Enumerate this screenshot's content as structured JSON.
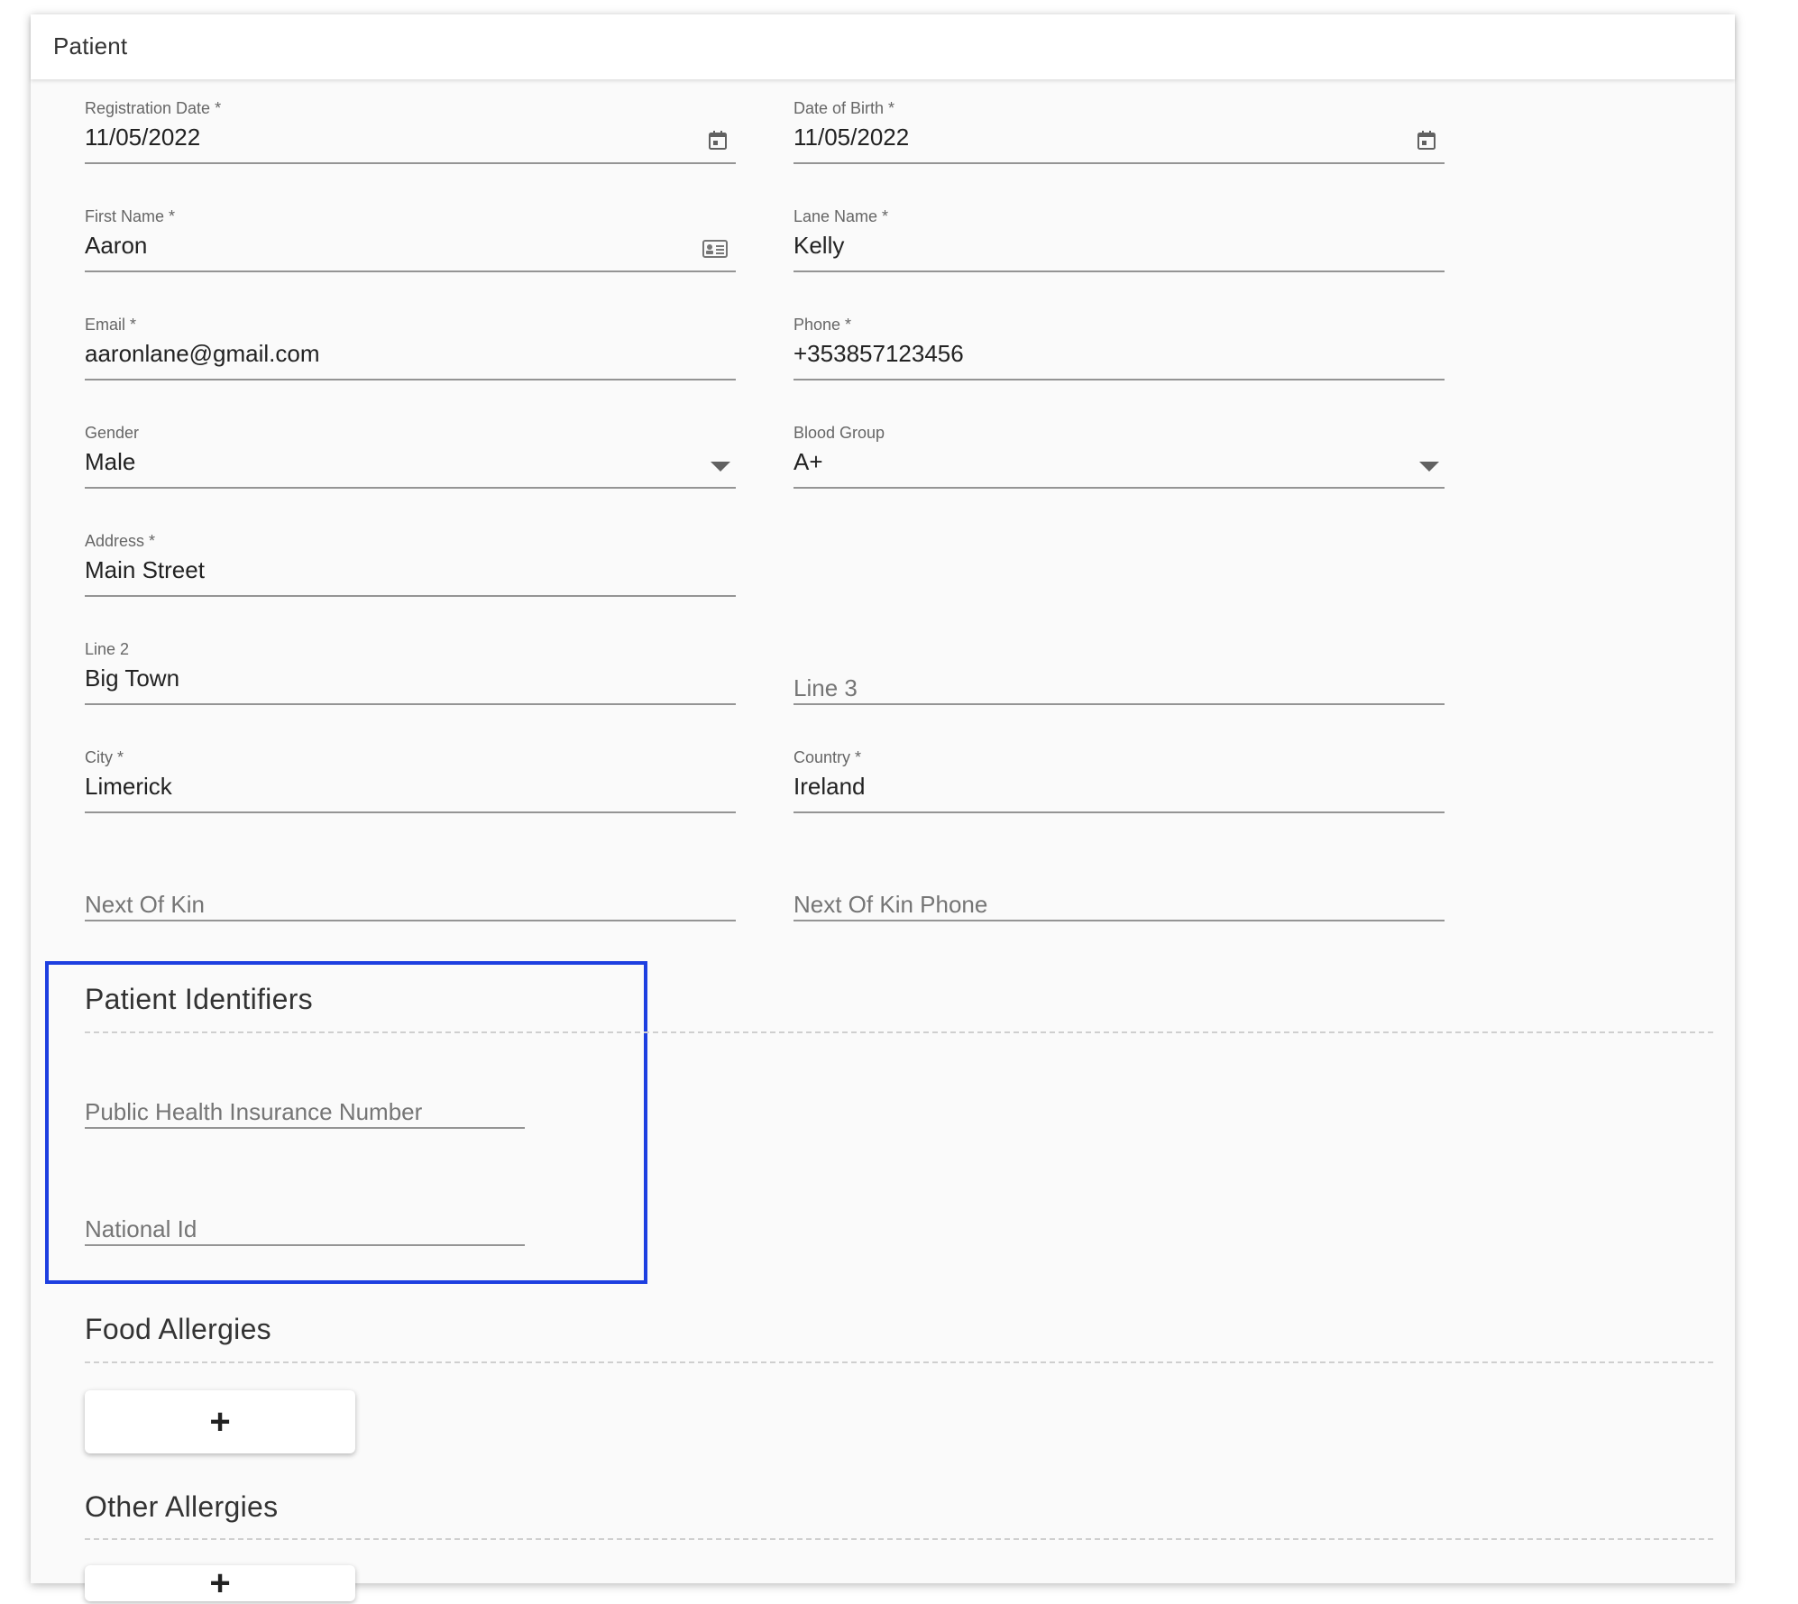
{
  "card": {
    "title": "Patient"
  },
  "fields": {
    "registration_date": {
      "label": "Registration Date *",
      "value": "11/05/2022"
    },
    "date_of_birth": {
      "label": "Date of Birth *",
      "value": "11/05/2022"
    },
    "first_name": {
      "label": "First Name *",
      "value": "Aaron"
    },
    "last_name": {
      "label": "Lane Name *",
      "value": "Kelly"
    },
    "email": {
      "label": "Email *",
      "value": "aaronlane@gmail.com"
    },
    "phone": {
      "label": "Phone *",
      "value": "+353857123456"
    },
    "gender": {
      "label": "Gender",
      "value": "Male"
    },
    "blood_group": {
      "label": "Blood Group",
      "value": "A+"
    },
    "address": {
      "label": "Address *",
      "value": "Main Street"
    },
    "line2": {
      "label": "Line 2",
      "value": "Big Town"
    },
    "line3": {
      "placeholder": "Line 3"
    },
    "city": {
      "label": "City *",
      "value": "Limerick"
    },
    "country": {
      "label": "Country *",
      "value": "Ireland"
    },
    "next_of_kin": {
      "placeholder": "Next Of Kin"
    },
    "next_of_kin_phone": {
      "placeholder": "Next Of Kin Phone"
    }
  },
  "identifiers": {
    "title": "Patient Identifiers",
    "phin": {
      "placeholder": "Public Health Insurance Number"
    },
    "national_id": {
      "placeholder": "National Id"
    }
  },
  "food_allergies": {
    "title": "Food Allergies",
    "add_label": "+"
  },
  "other_allergies": {
    "title": "Other Allergies",
    "add_label": "+"
  },
  "colors": {
    "highlight": "#1d3fe0",
    "underline": "#949494",
    "background": "#fafafa"
  },
  "icons": {
    "date": "calendar-icon",
    "name": "contact-card-icon",
    "select": "caret-down-icon"
  }
}
